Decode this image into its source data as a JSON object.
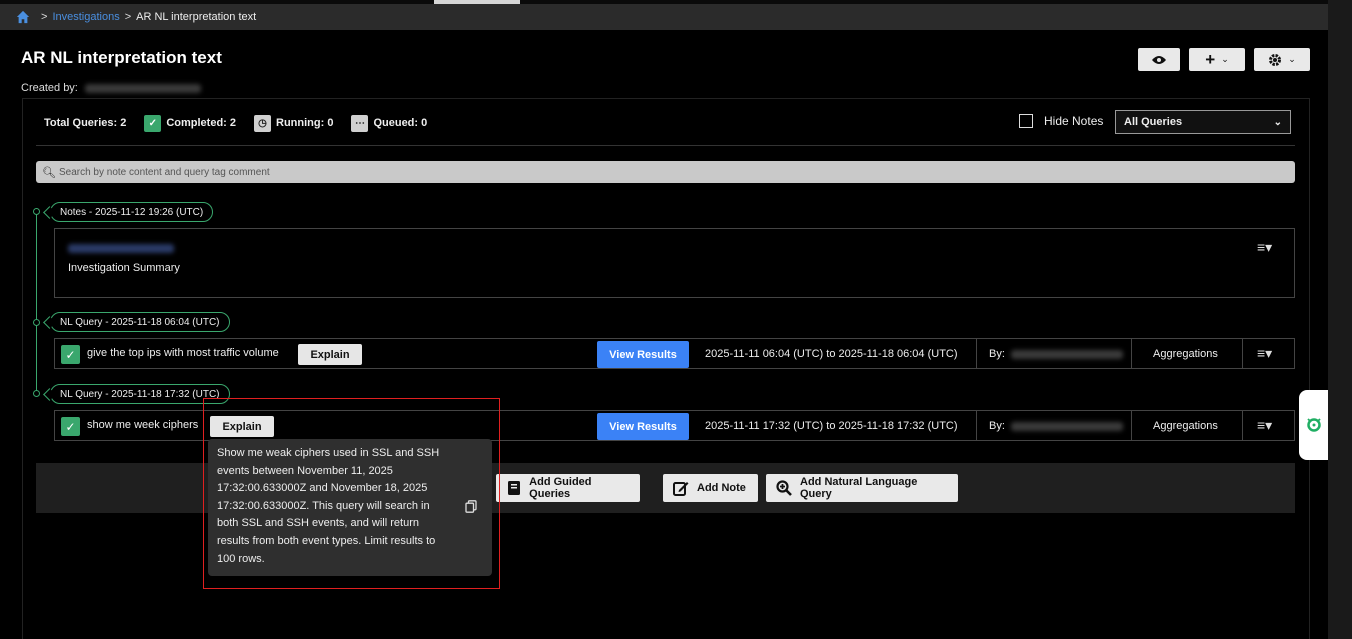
{
  "breadcrumb": {
    "link": "Investigations",
    "current": "AR NL interpretation text",
    "separator": ">"
  },
  "page": {
    "title": "AR NL interpretation text",
    "created_by_label": "Created by:"
  },
  "header_buttons": {
    "view": "eye-icon",
    "add": "+",
    "settings": "gear-icon"
  },
  "stats": {
    "total": "Total Queries: 2",
    "completed": "Completed: 2",
    "running": "Running: 0",
    "queued": "Queued: 0"
  },
  "hide_notes_label": "Hide Notes",
  "filter_select": {
    "value": "All Queries"
  },
  "search": {
    "placeholder": "Search by note content and query tag comment"
  },
  "timeline": [
    {
      "tag": "Notes - 2025-11-12 19:26 (UTC)"
    },
    {
      "tag": "NL Query - 2025-11-18 06:04 (UTC)"
    },
    {
      "tag": "NL Query - 2025-11-18 17:32 (UTC)"
    }
  ],
  "note": {
    "summary": "Investigation Summary"
  },
  "queries": [
    {
      "text": "give the top ips with most traffic volume",
      "explain_label": "Explain",
      "view_label": "View Results",
      "range": "2025-11-11 06:04 (UTC) to 2025-11-18 06:04 (UTC)",
      "by_label": "By:",
      "type": "Aggregations"
    },
    {
      "text": "show me week ciphers",
      "explain_label": "Explain",
      "view_label": "View Results",
      "range": "2025-11-11 17:32 (UTC) to 2025-11-18 17:32 (UTC)",
      "by_label": "By:",
      "type": "Aggregations"
    }
  ],
  "actions": {
    "guided": "Add Guided Queries",
    "note": "Add Note",
    "nl_query": "Add Natural Language Query"
  },
  "tooltip": {
    "text": "Show me weak ciphers used in SSL and SSH events between November 11, 2025 17:32:00.633000Z and November 18, 2025 17:32:00.633000Z. This query will search in both SSL and SSH events, and will return results from both event types. Limit results to 100 rows."
  },
  "colors": {
    "accent_green": "#3aa76d",
    "primary_blue": "#3b82f6",
    "link_blue": "#4a8fe0",
    "highlight_red": "#e02020"
  }
}
